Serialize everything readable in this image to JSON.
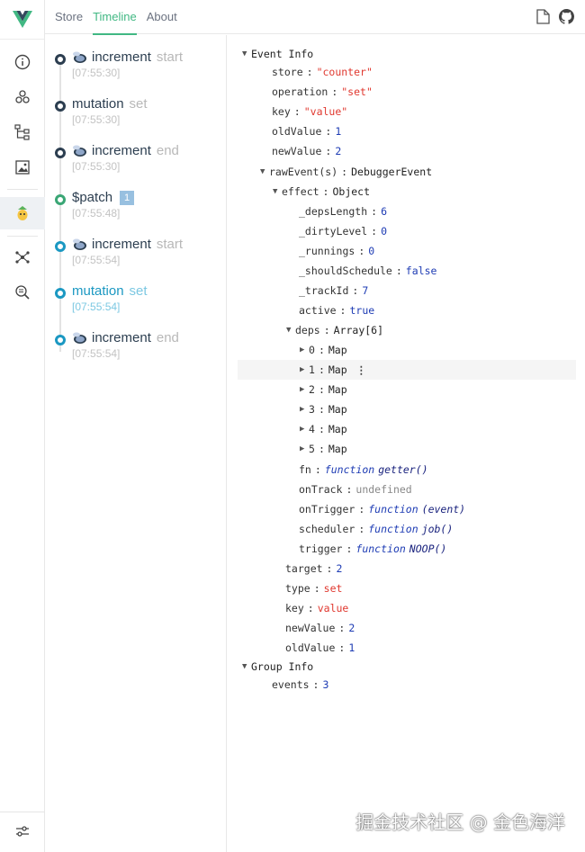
{
  "tabs": [
    "Store",
    "Timeline",
    "About"
  ],
  "timeline": [
    {
      "name": "increment",
      "sub": "start",
      "time": "[07:55:30]",
      "icon": "bee-icon",
      "dot": "dark"
    },
    {
      "name": "mutation",
      "sub": "set",
      "time": "[07:55:30]",
      "icon": "",
      "dot": "dark"
    },
    {
      "name": "increment",
      "sub": "end",
      "time": "[07:55:30]",
      "icon": "bee-icon",
      "dot": "dark"
    },
    {
      "name": "$patch",
      "sub": "",
      "badge": "1",
      "time": "[07:55:48]",
      "icon": "",
      "dot": "green"
    },
    {
      "name": "increment",
      "sub": "start",
      "time": "[07:55:54]",
      "icon": "bee-icon",
      "dot": "blue"
    },
    {
      "name": "mutation",
      "sub": "set",
      "time": "[07:55:54]",
      "icon": "",
      "dot": "blue",
      "selected": true
    },
    {
      "name": "increment",
      "sub": "end",
      "time": "[07:55:54]",
      "icon": "bee-icon",
      "dot": "blue"
    }
  ],
  "inspector": {
    "event_info": "Event Info",
    "store_key": "store",
    "store_val": "\"counter\"",
    "operation_key": "operation",
    "operation_val": "\"set\"",
    "key_key": "key",
    "key_val": "\"value\"",
    "oldValue_key": "oldValue",
    "oldValue_val": "1",
    "newValue_key": "newValue",
    "newValue_val": "2",
    "rawEvent_key": "rawEvent(s)",
    "rawEvent_val": "DebuggerEvent",
    "effect_key": "effect",
    "effect_val": "Object",
    "depsLength_key": "_depsLength",
    "depsLength_val": "6",
    "dirtyLevel_key": "_dirtyLevel",
    "dirtyLevel_val": "0",
    "runnings_key": "_runnings",
    "runnings_val": "0",
    "shouldSchedule_key": "_shouldSchedule",
    "shouldSchedule_val": "false",
    "trackId_key": "_trackId",
    "trackId_val": "7",
    "active_key": "active",
    "active_val": "true",
    "deps_key": "deps",
    "deps_val": "Array[6]",
    "deps_items": [
      "0",
      "1",
      "2",
      "3",
      "4",
      "5"
    ],
    "map_label": "Map",
    "fn_key": "fn",
    "fn_val": "getter()",
    "onTrack_key": "onTrack",
    "onTrack_val": "undefined",
    "onTrigger_key": "onTrigger",
    "onTrigger_val": "(event)",
    "scheduler_key": "scheduler",
    "scheduler_val": "job()",
    "trigger_key": "trigger",
    "trigger_val": "NOOP()",
    "function_word": "function",
    "target_key": "target",
    "target_val": "2",
    "type_key": "type",
    "type_val": "set",
    "key2_key": "key",
    "key2_val": "value",
    "newValue2_key": "newValue",
    "newValue2_val": "2",
    "oldValue2_key": "oldValue",
    "oldValue2_val": "1",
    "group_info": "Group Info",
    "events_key": "events",
    "events_val": "3",
    "more_icon": "⋮"
  },
  "watermark": "掘金技术社区 @ 金色海洋",
  "colors": {
    "accent": "#41b883",
    "selected": "#1b98c2",
    "string": "#e0382f",
    "number": "#1e3cb4"
  }
}
